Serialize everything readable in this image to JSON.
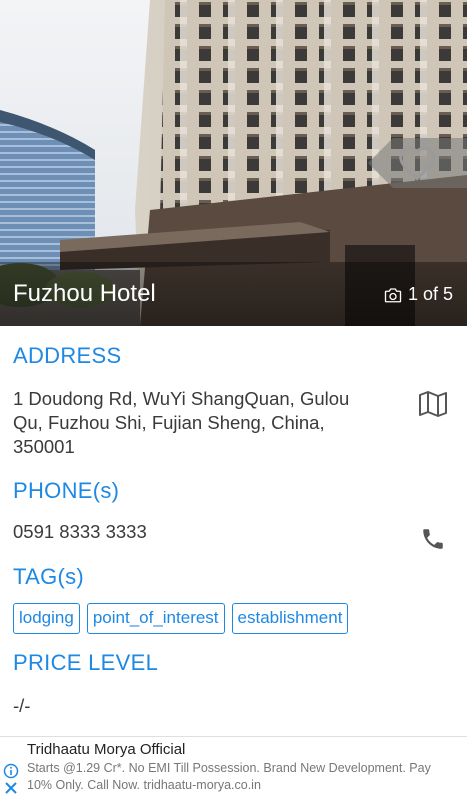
{
  "hero": {
    "hotel_name": "Fuzhou Hotel",
    "photo_counter": "1 of 5",
    "favorite_icon": "heart-outline-icon",
    "camera_icon": "camera-icon"
  },
  "address": {
    "title": "ADDRESS",
    "line1": "1 Doudong Rd, WuYi ShangQuan, Gulou",
    "line2": "Qu, Fuzhou Shi, Fujian Sheng, China,",
    "line3": "350001",
    "icon": "map-icon"
  },
  "phone": {
    "title": "PHONE(s)",
    "number": "0591 8333 3333",
    "icon": "phone-icon"
  },
  "tags": {
    "title": "TAG(s)",
    "items": [
      "lodging",
      "point_of_interest",
      "establishment"
    ]
  },
  "price": {
    "title": "PRICE LEVEL",
    "value": "-/-"
  },
  "ad": {
    "title": "Tridhaatu Morya Official",
    "description": "Starts @1.29 Cr*. No EMI Till Possession. Brand New Development. Pay 10% Only. Call Now. tridhaatu-morya.co.in",
    "info_icon": "info-icon",
    "close_icon": "close-icon"
  },
  "colors": {
    "accent": "#1e88e5",
    "text": "#3a3a3a",
    "icon_gray": "#555555"
  }
}
